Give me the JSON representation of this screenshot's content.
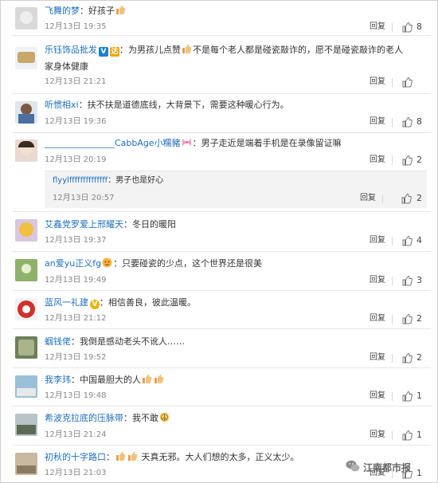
{
  "reply_label": "回复",
  "comments": [
    {
      "user": "飞舞的梦",
      "text": "好孩子",
      "date": "12月13日 19:35",
      "likes": "8"
    },
    {
      "user": "乐钰饰品批发",
      "text": "为男孩儿点赞",
      "text2": "不是每个老人都是碰瓷敲诈的，愿不是碰瓷敲诈的老人家身体健康",
      "date": "12月13日 21:21",
      "likes": ""
    },
    {
      "user": "听惯相xi",
      "text": "扶不扶是道德底线，大背景下，需要这种暖心行为。",
      "date": "12月13日 19:36",
      "likes": "8"
    },
    {
      "user": "________________CabbAge小糯豬",
      "text": "男子走近是端着手机是在录像留证嘛",
      "date": "12月13日 20:19",
      "likes": "2"
    },
    {
      "user": "艾鑫党罗爱上邢耀天",
      "text": "冬日的暖阳",
      "date": "12月13日 19:37",
      "likes": "4"
    },
    {
      "user": "an爱yu正义fg",
      "text": "只要碰瓷的少点，这个世界还是很美",
      "date": "12月13日 19:49",
      "likes": "3"
    },
    {
      "user": "蓝风一礼建",
      "text": "相信善良，彼此温暖。",
      "date": "12月13日 21:12",
      "likes": "2"
    },
    {
      "user": "蝈钱佬",
      "text": "我倒是感动老头不讹人……",
      "date": "12月13日 19:52",
      "likes": "2"
    },
    {
      "user": "我李玮",
      "text": "中国最胆大的人",
      "date": "12月13日 19:48",
      "likes": "1"
    },
    {
      "user": "希波克拉底的压脉带",
      "text": "我不敢",
      "date": "12月13日 21:24",
      "likes": "1"
    },
    {
      "user": "初秋的十字路口",
      "text": "天真无邪。大人们想的太多，正义太少。",
      "date": "12月13日 21:03",
      "likes": "1"
    }
  ],
  "sub_reply": {
    "user": "flyylffffffffffffff",
    "text": "男子也是好心",
    "date": "12月13日 20:57",
    "likes": "2"
  },
  "watermark": "江南都市报",
  "colors": {
    "link": "#1d6fbf",
    "text": "#333333",
    "meta": "#888888",
    "verified_blue": "#1a7fd4",
    "verified_gold": "#f0a400"
  }
}
